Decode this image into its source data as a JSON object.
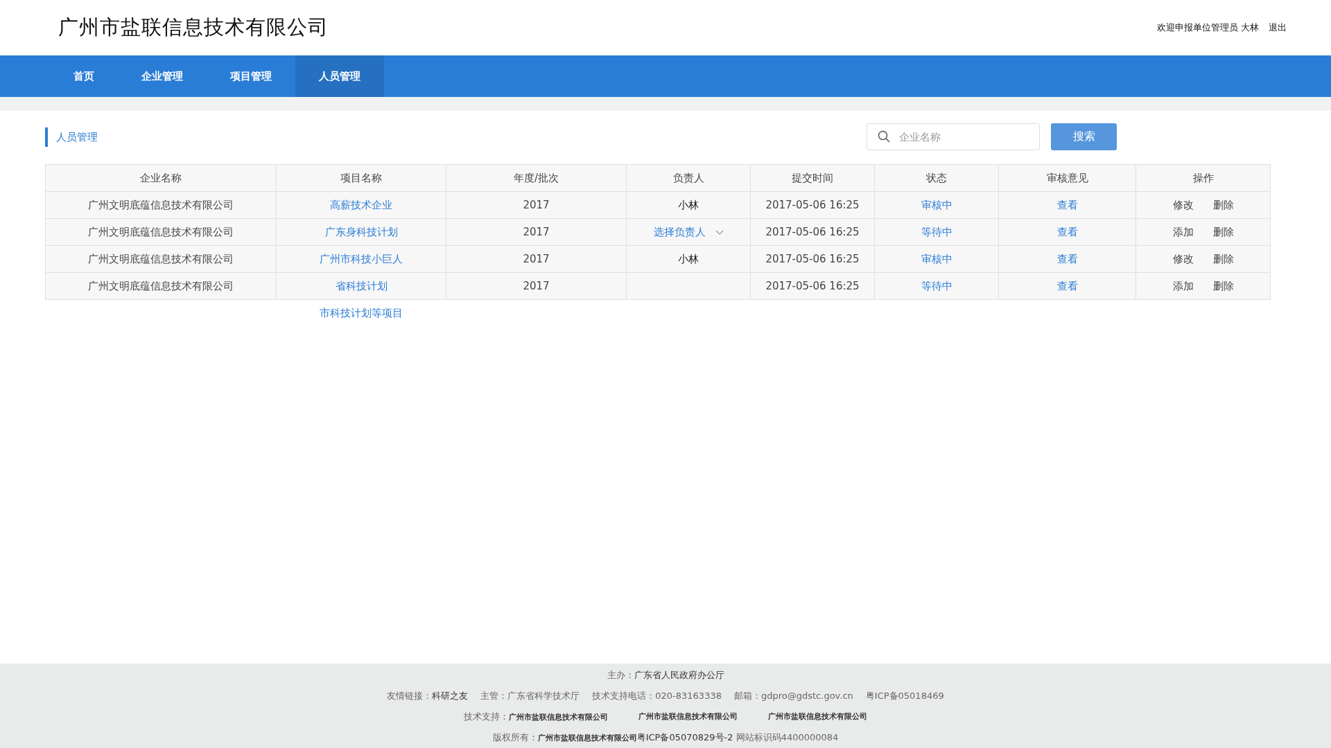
{
  "header": {
    "title": "广州市盐联信息技术有限公司",
    "welcome": "欢迎申报单位管理员 大林",
    "logout": "退出"
  },
  "nav": [
    {
      "label": "首页",
      "selected": false
    },
    {
      "label": "企业管理",
      "selected": false
    },
    {
      "label": "项目管理",
      "selected": false
    },
    {
      "label": "人员管理",
      "selected": true
    }
  ],
  "section_title": "人员管理",
  "search": {
    "placeholder": "企业名称",
    "button": "搜索"
  },
  "table": {
    "columns": [
      "企业名称",
      "项目名称",
      "年度/批次",
      "负责人",
      "提交时间",
      "状态",
      "审核意见",
      "操作"
    ],
    "rows": [
      {
        "company": "广州文明底蕴信息技术有限公司",
        "project": "高薪技术企业",
        "year": "2017",
        "owner": {
          "kind": "text",
          "text": "小林"
        },
        "time": "2017-05-06 16:25",
        "status": "审核中",
        "review": "查看",
        "actions": [
          "修改",
          "删除"
        ]
      },
      {
        "company": "广州文明底蕴信息技术有限公司",
        "project": "广东身科技计划",
        "year": "2017",
        "owner": {
          "kind": "select",
          "text": "选择负责人"
        },
        "time": "2017-05-06 16:25",
        "status": "等待中",
        "review": "查看",
        "actions": [
          "添加",
          "删除"
        ]
      },
      {
        "company": "广州文明底蕴信息技术有限公司",
        "project": "广州市科技小巨人",
        "year": "2017",
        "owner": {
          "kind": "text",
          "text": "小林"
        },
        "time": "2017-05-06 16:25",
        "status": "审核中",
        "review": "查看",
        "actions": [
          "修改",
          "删除"
        ]
      },
      {
        "company": "广州文明底蕴信息技术有限公司",
        "project": "省科技计划",
        "year": "2017",
        "time": "2017-05-06 16:25",
        "status": "等待中",
        "review": "查看",
        "actions": [
          "添加",
          "删除"
        ]
      }
    ],
    "extra_link": "市科技计划等项目"
  },
  "footer": {
    "lines": [
      [
        {
          "parts": [
            {
              "kind": "label",
              "text": "主办："
            },
            {
              "kind": "value",
              "text": "广东省人民政府办公厅"
            }
          ]
        }
      ],
      [
        {
          "parts": [
            {
              "kind": "label",
              "text": "友情链接："
            },
            {
              "kind": "value",
              "text": "科研之友"
            }
          ]
        },
        {
          "parts": [
            {
              "kind": "label",
              "text": "主管：广东省科学技术厅"
            }
          ]
        },
        {
          "parts": [
            {
              "kind": "label",
              "text": "技术支持电话：020-83163338"
            }
          ]
        },
        {
          "parts": [
            {
              "kind": "label",
              "text": "邮箱：gdpro@gdstc.gov.cn"
            }
          ]
        },
        {
          "parts": [
            {
              "kind": "label",
              "text": "粤ICP备05018469"
            }
          ]
        }
      ],
      [
        {
          "parts": [
            {
              "kind": "label",
              "text": "技术支持："
            },
            {
              "kind": "strong",
              "text": "广州市盐联信息技术有限公司"
            }
          ]
        },
        {
          "parts": [
            {
              "kind": "strong",
              "text": "广州市盐联信息技术有限公司"
            }
          ]
        },
        {
          "parts": [
            {
              "kind": "strong",
              "text": "广州市盐联信息技术有限公司"
            }
          ]
        }
      ],
      [
        {
          "parts": [
            {
              "kind": "label",
              "text": "版权所有："
            },
            {
              "kind": "strong",
              "text": "广州市盐联信息技术有限公司"
            },
            {
              "kind": "value",
              "text": "粤ICP备05070829号-2"
            },
            {
              "kind": "label",
              "text": " 网站标识码4400000084"
            }
          ]
        }
      ]
    ]
  }
}
